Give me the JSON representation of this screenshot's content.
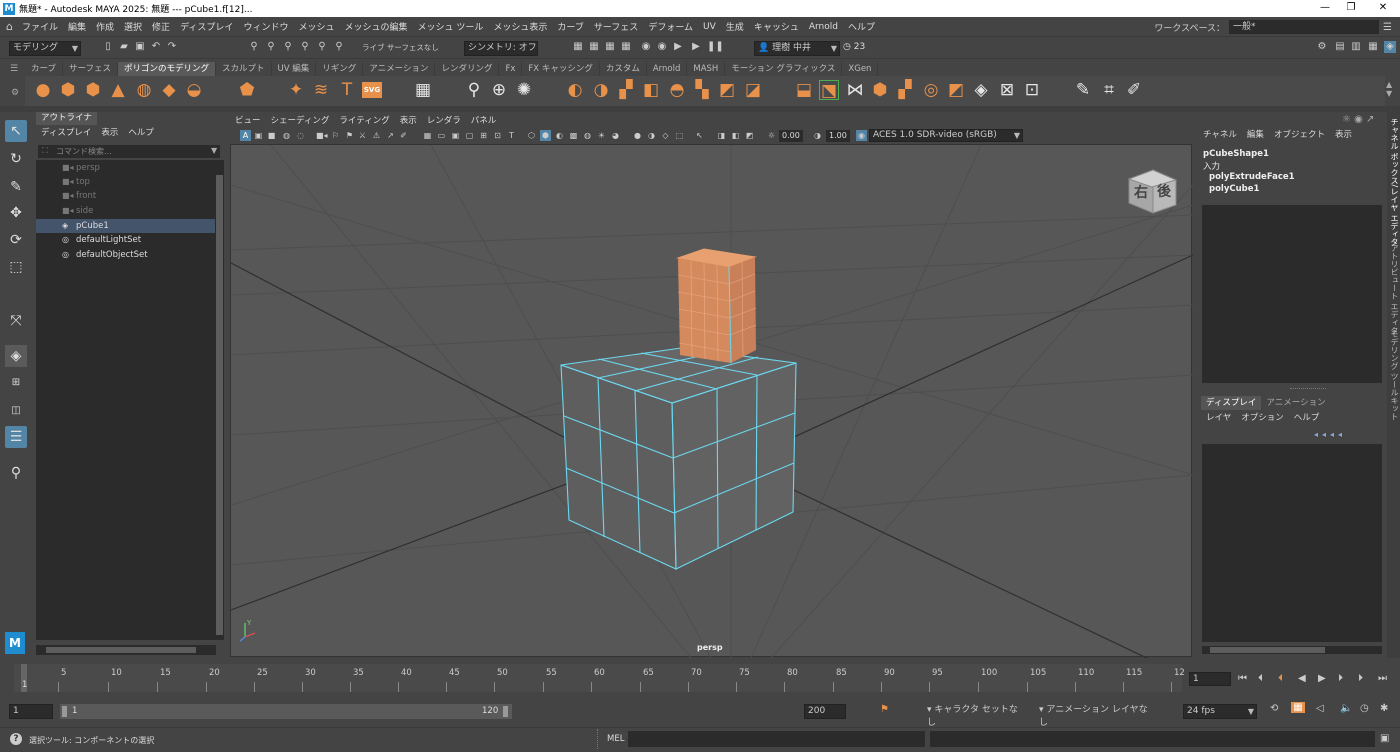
{
  "titlebar": {
    "text": "無題* - Autodesk MAYA 2025: 無題   ---   pCube1.f[12]...",
    "minimize": "—",
    "maximize": "❐",
    "close": "✕"
  },
  "menubar": {
    "items": [
      "ファイル",
      "編集",
      "作成",
      "選択",
      "修正",
      "ディスプレイ",
      "ウィンドウ",
      "メッシュ",
      "メッシュの編集",
      "メッシュ ツール",
      "メッシュ表示",
      "カーブ",
      "サーフェス",
      "デフォーム",
      "UV",
      "生成",
      "キャッシュ",
      "Arnold",
      "ヘルプ"
    ]
  },
  "workspace": {
    "label": "ワークスペース：",
    "value": "一般*"
  },
  "statusline": {
    "mode": "モデリング",
    "live": "ライブ サーフェスなし",
    "symmetry": "シンメトリ: オフ",
    "user": "理樹 中井",
    "notify_count": "23"
  },
  "shelf": {
    "tabs": [
      "カーブ",
      "サーフェス",
      "ポリゴンのモデリング",
      "スカルプト",
      "UV 編集",
      "リギング",
      "アニメーション",
      "レンダリング",
      "Fx",
      "FX キャッシング",
      "カスタム",
      "Arnold",
      "MASH",
      "モーション グラフィックス",
      "XGen"
    ],
    "active_tab": "ポリゴンのモデリング",
    "svg_label": "SVG",
    "text_label": "T"
  },
  "outliner": {
    "title": "アウトライナ",
    "menu": [
      "ディスプレイ",
      "表示",
      "ヘルプ"
    ],
    "search_placeholder": "コマンド検索...",
    "items": [
      {
        "label": "persp",
        "dim": true
      },
      {
        "label": "top",
        "dim": true
      },
      {
        "label": "front",
        "dim": true
      },
      {
        "label": "side",
        "dim": true
      },
      {
        "label": "pCube1",
        "dim": false,
        "selected": true
      },
      {
        "label": "defaultLightSet",
        "dim": false
      },
      {
        "label": "defaultObjectSet",
        "dim": false
      }
    ]
  },
  "viewport": {
    "menu": [
      "ビュー",
      "シェーディング",
      "ライティング",
      "表示",
      "レンダラ",
      "パネル"
    ],
    "exposure": "0.00",
    "gamma": "1.00",
    "colorspace": "ACES 1.0 SDR-video (sRGB)",
    "camera_label": "persp",
    "viewcube": {
      "right": "右",
      "back": "後"
    },
    "axis_label": "Y"
  },
  "channelbox": {
    "menu": [
      "チャネル",
      "編集",
      "オブジェクト",
      "表示"
    ],
    "shape": "pCubeShape1",
    "inputs_label": "入力",
    "inputs": [
      "polyExtrudeFace1",
      "polyCube1"
    ]
  },
  "layers": {
    "tabs": [
      "ディスプレイ",
      "アニメーション"
    ],
    "active_tab": "ディスプレイ",
    "menu": [
      "レイヤ",
      "オプション",
      "ヘルプ"
    ]
  },
  "sidetabs": [
    "チャネル ボックス/レイヤ エディタ",
    "アトリビュート エディタ",
    "モデリング ツールキット"
  ],
  "timeline": {
    "ticks": [
      "5",
      "10",
      "15",
      "20",
      "25",
      "30",
      "35",
      "40",
      "45",
      "50",
      "55",
      "60",
      "65",
      "70",
      "75",
      "80",
      "85",
      "90",
      "95",
      "100",
      "105",
      "110",
      "115",
      "12"
    ],
    "current_start": "1",
    "current_frame": "1"
  },
  "range": {
    "start": "1",
    "inner_start": "1",
    "inner_end": "120",
    "end": "200",
    "character_set": "キャラクタ セットなし",
    "anim_layer": "アニメーション レイヤなし",
    "fps": "24 fps"
  },
  "commandline": {
    "help_text": "選択ツール: コンポーネントの選択",
    "mel_label": "MEL"
  }
}
